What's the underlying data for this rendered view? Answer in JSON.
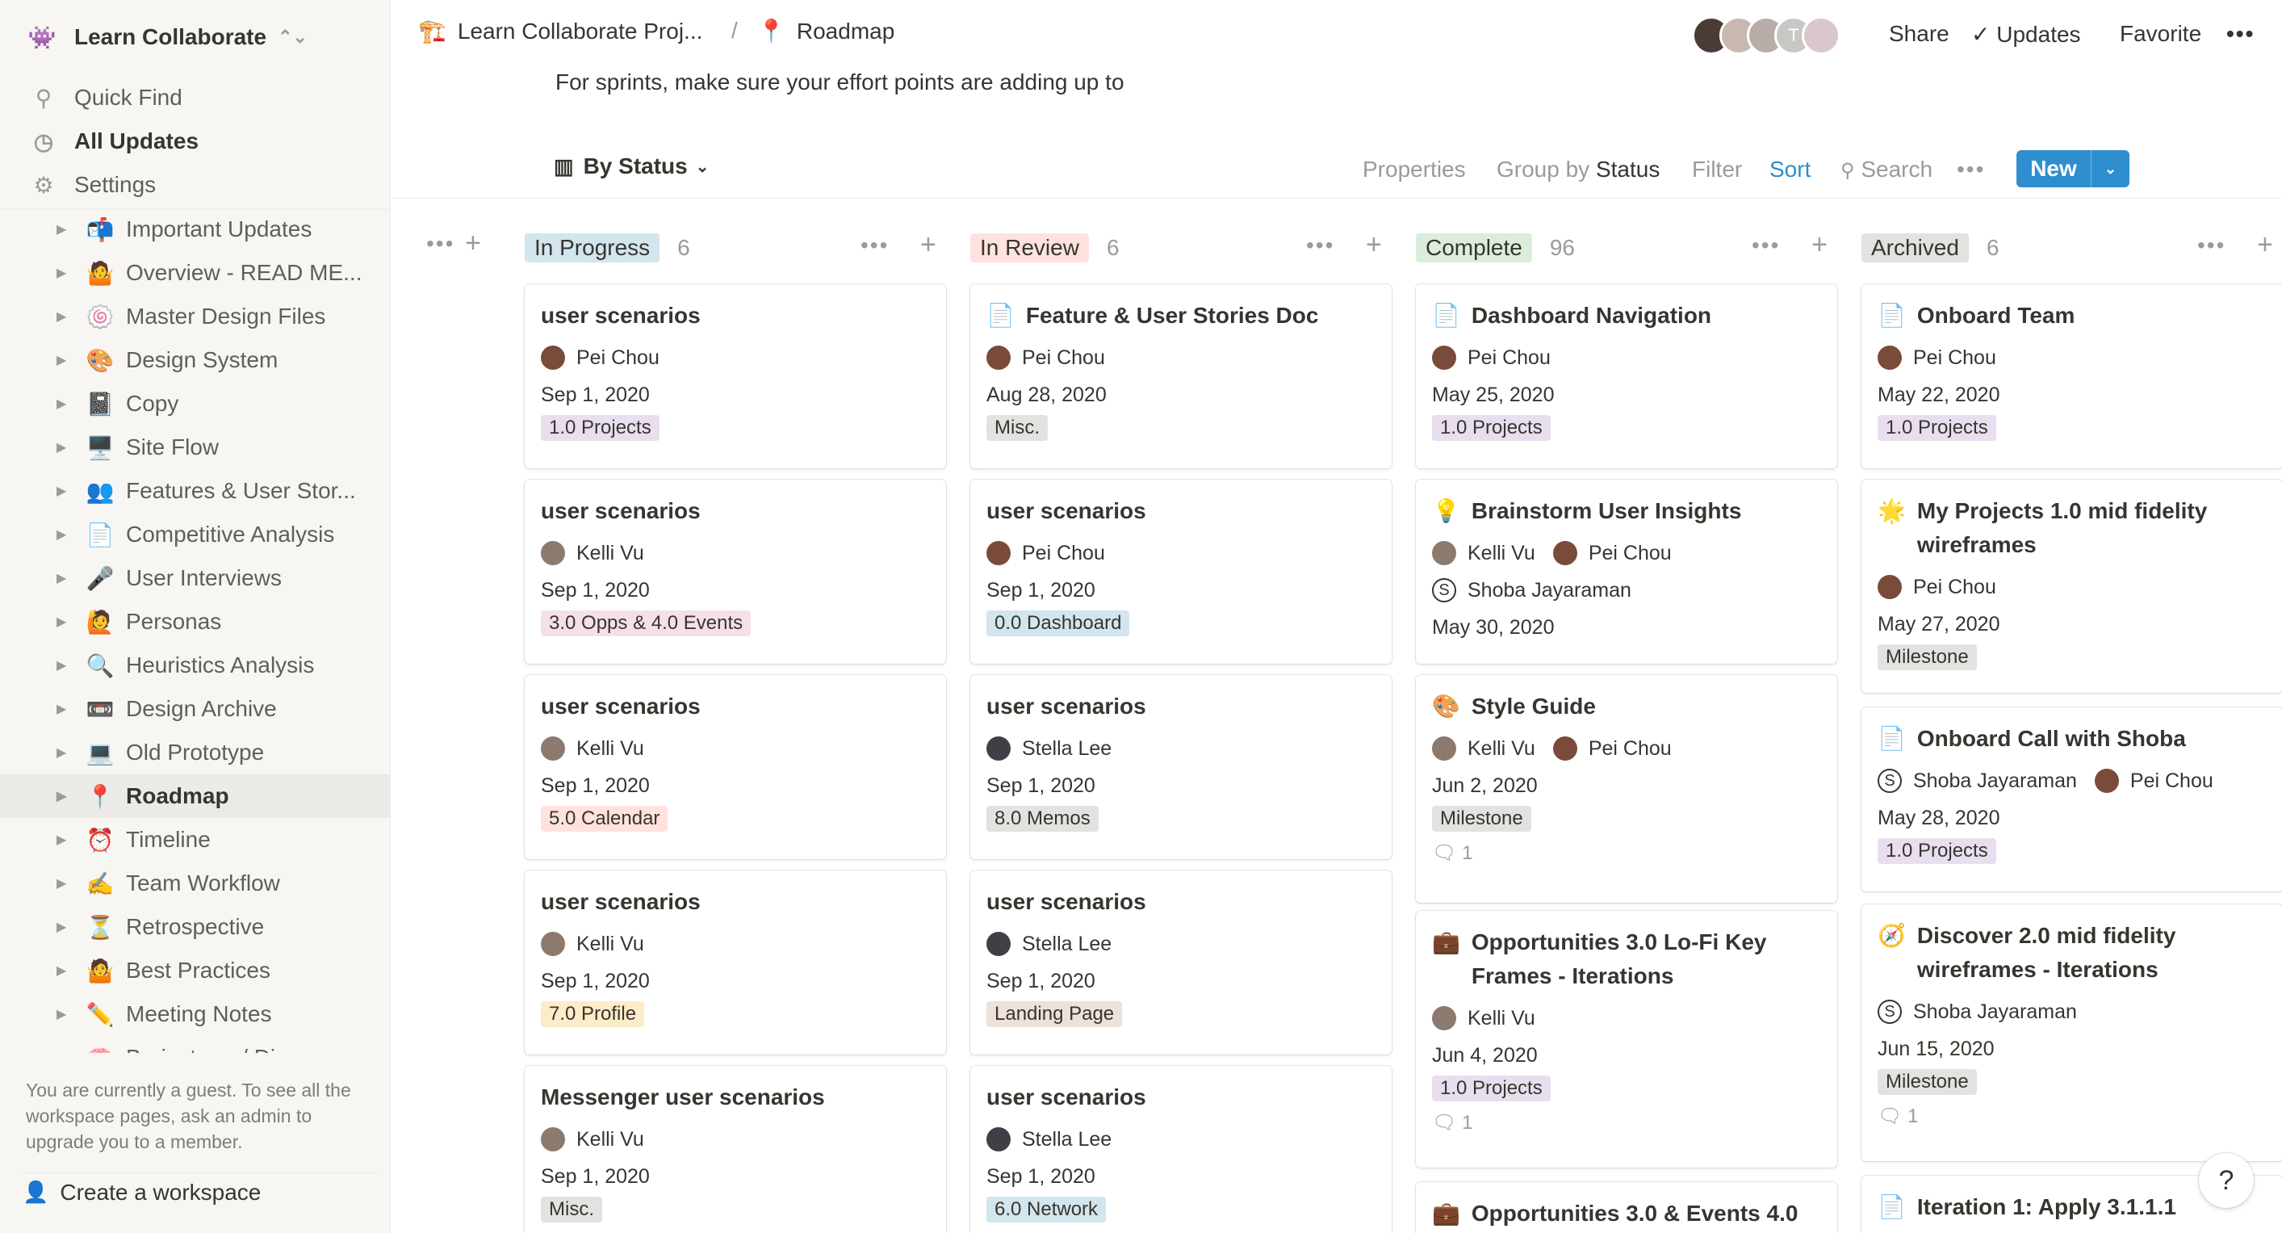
{
  "workspace": {
    "name": "Learn Collaborate",
    "icon": "👾"
  },
  "nav": [
    {
      "label": "Quick Find",
      "icon": "search-icon",
      "glyph": "⚲"
    },
    {
      "label": "All Updates",
      "icon": "clock-icon",
      "glyph": "◷"
    },
    {
      "label": "Settings",
      "icon": "gear-icon",
      "glyph": "⚙"
    }
  ],
  "pages": [
    {
      "emoji": "📬",
      "label": "Important Updates"
    },
    {
      "emoji": "🤷",
      "label": "Overview - READ ME..."
    },
    {
      "emoji": "🍥",
      "label": "Master Design Files"
    },
    {
      "emoji": "🎨",
      "label": "Design System"
    },
    {
      "emoji": "📓",
      "label": "Copy"
    },
    {
      "emoji": "🖥️",
      "label": "Site Flow"
    },
    {
      "emoji": "👥",
      "label": "Features & User Stor..."
    },
    {
      "emoji": "📄",
      "label": "Competitive Analysis"
    },
    {
      "emoji": "🎤",
      "label": "User Interviews"
    },
    {
      "emoji": "🙋",
      "label": "Personas"
    },
    {
      "emoji": "🔍",
      "label": "Heuristics Analysis"
    },
    {
      "emoji": "📼",
      "label": "Design Archive"
    },
    {
      "emoji": "💻",
      "label": "Old Prototype"
    },
    {
      "emoji": "📍",
      "label": "Roadmap",
      "active": true
    },
    {
      "emoji": "⏰",
      "label": "Timeline"
    },
    {
      "emoji": "✍️",
      "label": "Team Workflow"
    },
    {
      "emoji": "⏳",
      "label": "Retrospective"
    },
    {
      "emoji": "🤷",
      "label": "Best Practices"
    },
    {
      "emoji": "✏️",
      "label": "Meeting Notes"
    },
    {
      "emoji": "🧠",
      "label": "Brainstorm / Discuss"
    }
  ],
  "guest_note": "You are currently a guest. To see all the workspace pages, ask an admin to upgrade you to a member.",
  "create_workspace": "Create a workspace",
  "breadcrumb": {
    "project": "Learn Collaborate Proj...",
    "project_emoji": "🏗️",
    "separator": "/",
    "page": "Roadmap",
    "page_emoji": "📍"
  },
  "top_actions": {
    "share": "Share",
    "updates": "Updates",
    "favorite": "Favorite",
    "more": "•••"
  },
  "avatar_letter": "T",
  "intro_text": "For sprints, make sure your effort points are adding up to",
  "view": {
    "name": "By Status",
    "properties": "Properties",
    "group_by": "Group by",
    "group_value": "Status",
    "filter": "Filter",
    "sort": "Sort",
    "search": "Search",
    "more": "•••",
    "new": "New"
  },
  "columns": [
    {
      "status": "In Progress",
      "count": "6",
      "color_class": "st-progress",
      "cards": [
        {
          "title": "user scenarios",
          "people": [
            {
              "name": "Pei Chou",
              "av": "pei"
            }
          ],
          "date": "Sep 1, 2020",
          "tag": "1.0 Projects",
          "tag_class": "tag-purple"
        },
        {
          "title": "user scenarios",
          "people": [
            {
              "name": "Kelli Vu",
              "av": "kelli"
            }
          ],
          "date": "Sep 1, 2020",
          "tag": "3.0 Opps & 4.0 Events",
          "tag_class": "tag-pink"
        },
        {
          "title": "user scenarios",
          "people": [
            {
              "name": "Kelli Vu",
              "av": "kelli"
            }
          ],
          "date": "Sep 1, 2020",
          "tag": "5.0 Calendar",
          "tag_class": "tag-red"
        },
        {
          "title": "user scenarios",
          "people": [
            {
              "name": "Kelli Vu",
              "av": "kelli"
            }
          ],
          "date": "Sep 1, 2020",
          "tag": "7.0 Profile",
          "tag_class": "tag-yellow"
        },
        {
          "title": "Messenger user scenarios",
          "people": [
            {
              "name": "Kelli Vu",
              "av": "kelli"
            }
          ],
          "date": "Sep 1, 2020",
          "tag": "Misc.",
          "tag_class": "tag-gray"
        }
      ]
    },
    {
      "status": "In Review",
      "count": "6",
      "color_class": "st-review",
      "cards": [
        {
          "emoji": "📄",
          "title": "Feature & User Stories Doc",
          "people": [
            {
              "name": "Pei Chou",
              "av": "pei"
            }
          ],
          "date": "Aug 28, 2020",
          "tag": "Misc.",
          "tag_class": "tag-gray"
        },
        {
          "title": "user scenarios",
          "people": [
            {
              "name": "Pei Chou",
              "av": "pei"
            }
          ],
          "date": "Sep 1, 2020",
          "tag": "0.0 Dashboard",
          "tag_class": "tag-blue"
        },
        {
          "title": "user scenarios",
          "people": [
            {
              "name": "Stella Lee",
              "av": "stella"
            }
          ],
          "date": "Sep 1, 2020",
          "tag": "8.0 Memos",
          "tag_class": "tag-gray"
        },
        {
          "title": "user scenarios",
          "people": [
            {
              "name": "Stella Lee",
              "av": "stella"
            }
          ],
          "date": "Sep 1, 2020",
          "tag": "Landing Page",
          "tag_class": "tag-brown"
        },
        {
          "title": "user scenarios",
          "people": [
            {
              "name": "Stella Lee",
              "av": "stella"
            }
          ],
          "date": "Sep 1, 2020",
          "tag": "6.0 Network",
          "tag_class": "tag-blue"
        }
      ]
    },
    {
      "status": "Complete",
      "count": "96",
      "color_class": "st-complete",
      "cards": [
        {
          "emoji": "📄",
          "title": "Dashboard Navigation",
          "people": [
            {
              "name": "Pei Chou",
              "av": "pei"
            }
          ],
          "date": "May 25, 2020",
          "tag": "1.0 Projects",
          "tag_class": "tag-purple"
        },
        {
          "emoji": "💡",
          "title": "Brainstorm User Insights",
          "people": [
            {
              "name": "Kelli Vu",
              "av": "kelli"
            },
            {
              "name": "Pei Chou",
              "av": "pei"
            },
            {
              "name": "Shoba Jayaraman",
              "av": "shoba"
            }
          ],
          "date": "May 30, 2020"
        },
        {
          "emoji": "🎨",
          "title": "Style Guide",
          "people": [
            {
              "name": "Kelli Vu",
              "av": "kelli"
            },
            {
              "name": "Pei Chou",
              "av": "pei"
            }
          ],
          "date": "Jun 2, 2020",
          "tag": "Milestone",
          "tag_class": "tag-gray",
          "comments": "1"
        },
        {
          "emoji": "💼",
          "title": "Opportunities 3.0 Lo-Fi Key Frames  - Iterations",
          "people": [
            {
              "name": "Kelli Vu",
              "av": "kelli"
            }
          ],
          "date": "Jun 4, 2020",
          "tag": "1.0 Projects",
          "tag_class": "tag-purple",
          "comments": "1"
        },
        {
          "emoji": "💼",
          "title": "Opportunities 3.0 & Events 4.0"
        }
      ]
    },
    {
      "status": "Archived",
      "count": "6",
      "color_class": "st-archived",
      "cards": [
        {
          "emoji": "📄",
          "title": "Onboard Team",
          "people": [
            {
              "name": "Pei Chou",
              "av": "pei"
            }
          ],
          "date": "May 22, 2020",
          "tag": "1.0 Projects",
          "tag_class": "tag-purple"
        },
        {
          "emoji": "🌟",
          "title": "My Projects 1.0 mid fidelity wireframes",
          "people": [
            {
              "name": "Pei Chou",
              "av": "pei"
            }
          ],
          "date": "May 27, 2020",
          "tag": "Milestone",
          "tag_class": "tag-gray"
        },
        {
          "emoji": "📄",
          "title": "Onboard Call with Shoba",
          "people": [
            {
              "name": "Shoba Jayaraman",
              "av": "shoba"
            },
            {
              "name": "Pei Chou",
              "av": "pei"
            }
          ],
          "date": "May 28, 2020",
          "tag": "1.0 Projects",
          "tag_class": "tag-purple"
        },
        {
          "emoji": "🧭",
          "title": "Discover 2.0 mid fidelity wireframes - Iterations",
          "people": [
            {
              "name": "Shoba Jayaraman",
              "av": "shoba"
            }
          ],
          "date": "Jun 15, 2020",
          "tag": "Milestone",
          "tag_class": "tag-gray",
          "comments": "1"
        },
        {
          "emoji": "📄",
          "title": "Iteration 1: Apply 3.1.1.1"
        }
      ]
    }
  ],
  "help": "?"
}
